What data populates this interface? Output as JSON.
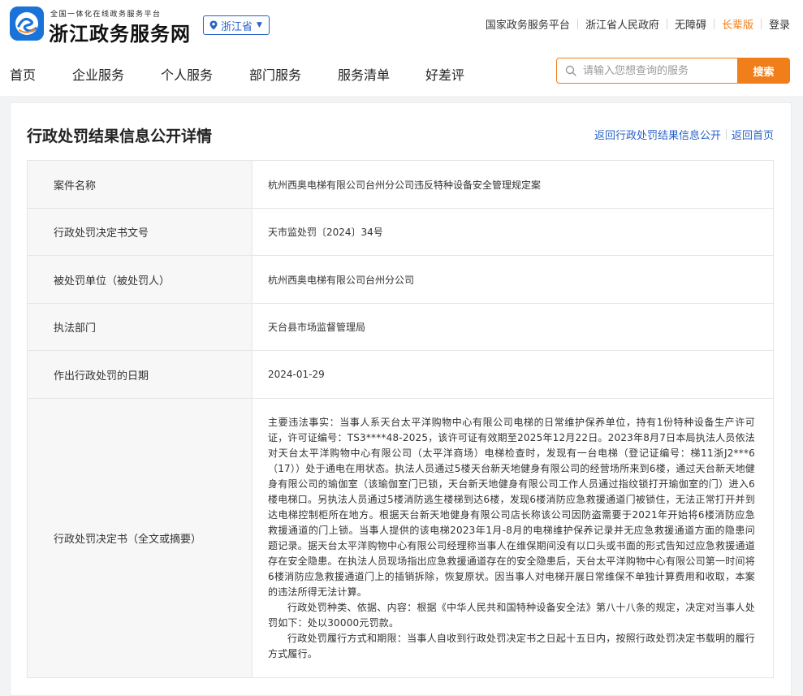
{
  "header": {
    "logo_sub": "全国一体化在线政务服务平台",
    "logo_main": "浙江政务服务网",
    "region": "浙江省",
    "links": [
      {
        "label": "国家政务服务平台"
      },
      {
        "label": "浙江省人民政府"
      },
      {
        "label": "无障碍"
      },
      {
        "label": "长辈版"
      },
      {
        "label": "登录"
      }
    ]
  },
  "nav": {
    "items": [
      {
        "label": "首页"
      },
      {
        "label": "企业服务"
      },
      {
        "label": "个人服务"
      },
      {
        "label": "部门服务"
      },
      {
        "label": "服务清单"
      },
      {
        "label": "好差评"
      }
    ]
  },
  "search": {
    "placeholder": "请输入您想查询的服务",
    "button": "搜索"
  },
  "colors": {
    "accent": "#f07e1b",
    "link": "#2a63c7",
    "brand": "#1a73d9"
  },
  "detail": {
    "title": "行政处罚结果信息公开详情",
    "back_list": "返回行政处罚结果信息公开",
    "back_home": "返回首页",
    "rows": [
      {
        "label": "案件名称",
        "value": "杭州西奥电梯有限公司台州分公司违反特种设备安全管理规定案"
      },
      {
        "label": "行政处罚决定书文号",
        "value": "天市监处罚〔2024〕34号"
      },
      {
        "label": "被处罚单位（被处罚人）",
        "value": "杭州西奥电梯有限公司台州分公司"
      },
      {
        "label": "执法部门",
        "value": "天台县市场监督管理局"
      },
      {
        "label": "作出行政处罚的日期",
        "value": "2024-01-29"
      }
    ],
    "decision": {
      "label": "行政处罚决定书（全文或摘要）",
      "p1": "主要违法事实：当事人系天台太平洋购物中心有限公司电梯的日常维护保养单位，持有1份特种设备生产许可证，许可证编号：TS3****48-2025，该许可证有效期至2025年12月22日。2023年8月7日本局执法人员依法对天台太平洋购物中心有限公司（太平洋商场）电梯检查时，发现有一台电梯（登记证编号：梯11浙J2***6（17））处于通电在用状态。执法人员通过5楼天台新天地健身有限公司的经营场所来到6楼，通过天台新天地健身有限公司的瑜伽室（该瑜伽室门已锁，天台新天地健身有限公司工作人员通过指纹锁打开瑜伽室的门）进入6楼电梯口。另执法人员通过5楼消防逃生楼梯到达6楼，发现6楼消防应急救援通道门被锁住，无法正常打开并到达电梯控制柜所在地方。根据天台新天地健身有限公司店长称该公司因防盗需要于2021年开始将6楼消防应急救援通道的门上锁。当事人提供的该电梯2023年1月-8月的电梯维护保养记录并无应急救援通道方面的隐患问题记录。据天台太平洋购物中心有限公司经理称当事人在维保期间没有以口头或书面的形式告知过应急救援通道存在安全隐患。在执法人员现场指出应急救援通道存在的安全隐患后，天台太平洋购物中心有限公司第一时间将6楼消防应急救援通道门上的插销拆除，恢复原状。因当事人对电梯开展日常维保不单独计算费用和收取，本案的违法所得无法计算。",
      "p2": "行政处罚种类、依据、内容：根据《中华人民共和国特种设备安全法》第八十八条的规定，决定对当事人处罚如下：处以30000元罚款。",
      "p3": "行政处罚履行方式和期限：当事人自收到行政处罚决定书之日起十五日内，按照行政处罚决定书载明的履行方式履行。"
    }
  }
}
